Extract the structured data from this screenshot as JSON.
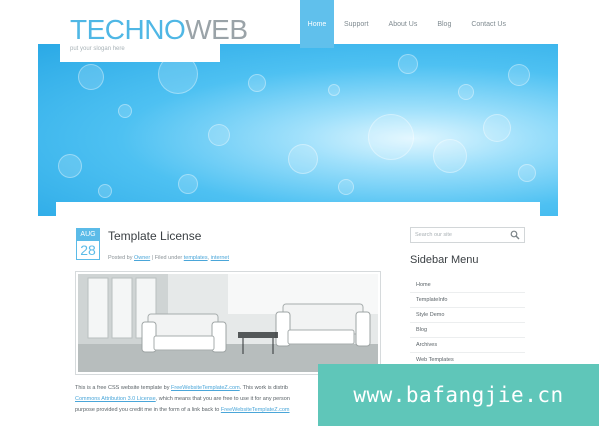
{
  "brand": {
    "logo_part1": "TECHNO",
    "logo_part2": "WEB",
    "slogan": "put your slogan here"
  },
  "nav": {
    "items": [
      {
        "label": "Home",
        "active": true
      },
      {
        "label": "Support",
        "active": false
      },
      {
        "label": "About Us",
        "active": false
      },
      {
        "label": "Blog",
        "active": false
      },
      {
        "label": "Contact Us",
        "active": false
      }
    ]
  },
  "post": {
    "month": "AUG",
    "day": "28",
    "title": "Template License",
    "meta_prefix": "Posted by",
    "author": "Owner",
    "meta_middle": "| Filed under",
    "category1": "templates",
    "category2": "internet",
    "text_line1": "This is a free CSS website template by",
    "text_link1": "FreeWebsiteTemplateZ.com",
    "text_line1_end": ". This work is distrib",
    "text_link2": "Commons Attribution 3.0 License",
    "text_line2_end": ", which means that you are free to use it for any person",
    "text_line3": "purpose provided you credit me in the form of a link back to",
    "text_link3": "FreeWebsiteTemplateZ.com"
  },
  "sidebar": {
    "search_placeholder": "Search our site",
    "title": "Sidebar Menu",
    "menu": [
      "Home",
      "TemplateInfo",
      "Style Demo",
      "Blog",
      "Archives",
      "Web Templates"
    ]
  },
  "watermark": {
    "text": "www.bafangjie.cn"
  },
  "colors": {
    "accent": "#60c0ec",
    "watermark_bg": "#5fc6b9"
  }
}
